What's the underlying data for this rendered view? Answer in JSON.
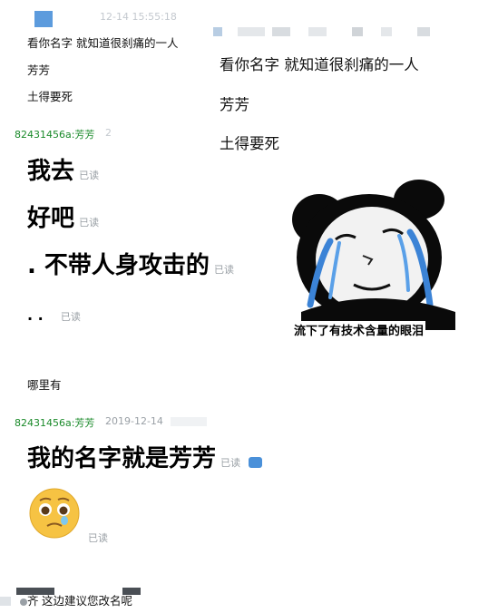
{
  "top_left": {
    "timestamp_partial": "12-14 15:55:18",
    "lines": [
      "看你名字 就知道很刹痛的一人",
      "芳芳",
      "土得要死"
    ]
  },
  "quoted_panel": {
    "lines": [
      "看你名字 就知道很刹痛的一人",
      "芳芳",
      "土得要死"
    ]
  },
  "message_group_1": {
    "sender": "82431456a:芳芳",
    "timestamp_partial": "2",
    "messages": [
      {
        "text": "我去",
        "status": "已读"
      },
      {
        "text": "好吧",
        "status": "已读"
      },
      {
        "text": ". 不带人身攻击的",
        "status": "已读"
      },
      {
        "text": ". .",
        "status": "已读"
      }
    ],
    "sticker_caption": "流下了有技术含量的眼泪",
    "sticker_icon": "crying-panda-meme"
  },
  "other_reply": {
    "text": "哪里有"
  },
  "message_group_2": {
    "sender": "82431456a:芳芳",
    "timestamp": "2019-12-14",
    "messages": [
      {
        "text": "我的名字就是芳芳",
        "status": "已读"
      },
      {
        "emoji": "pleading-face-emoji",
        "status": "已读"
      }
    ]
  },
  "bottom_line": {
    "text": "这边建议您改名呢",
    "prefix": "齐"
  },
  "colors": {
    "sender_green": "#1a8a2a",
    "read_gray": "#9aa0a6",
    "accent_blue": "#4a90d9"
  }
}
